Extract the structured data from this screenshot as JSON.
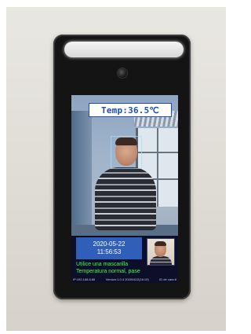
{
  "device": {
    "temperature_display": "Temp:36.5℃",
    "date": "2020-05-22",
    "time": "11:56:53",
    "message_mask": "Utilice una mascarilla",
    "message_temp": "Temperatura normal, pase",
    "footer_ip": "IP:192.168.8.86",
    "footer_version": "Version:1.0.4 20200422(16:19)",
    "footer_id": "ID de cara:8"
  },
  "colors": {
    "temp_text": "#1f4fa8",
    "message_text": "#35ff4a",
    "datetime_bg": "#2f5fb8",
    "info_panel_bg": "#0d0f2a"
  }
}
